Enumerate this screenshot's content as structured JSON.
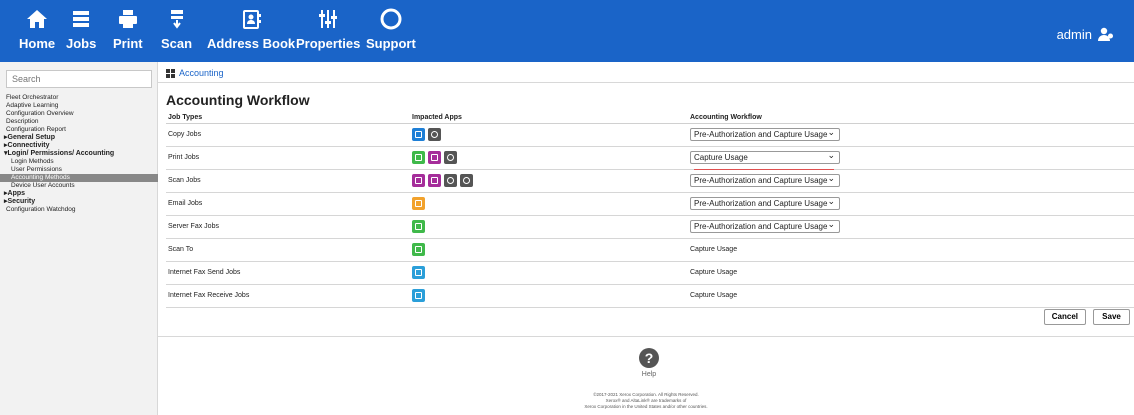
{
  "topbar": {
    "nav": [
      {
        "label": "Home",
        "icon": "home-icon"
      },
      {
        "label": "Jobs",
        "icon": "jobs-icon"
      },
      {
        "label": "Print",
        "icon": "print-icon"
      },
      {
        "label": "Scan",
        "icon": "scan-icon"
      },
      {
        "label": "Address Book",
        "icon": "address-book-icon"
      },
      {
        "label": "Properties",
        "icon": "properties-icon"
      },
      {
        "label": "Support",
        "icon": "support-icon"
      }
    ],
    "user": "admin",
    "bar_color": "#1a64c8"
  },
  "sidebar": {
    "search_placeholder": "Search",
    "items": [
      {
        "label": "Fleet Orchestrator",
        "kind": "item"
      },
      {
        "label": "Adaptive Learning",
        "kind": "item"
      },
      {
        "label": "Configuration Overview",
        "kind": "item"
      },
      {
        "label": "Description",
        "kind": "item"
      },
      {
        "label": "Configuration Report",
        "kind": "item"
      },
      {
        "label": "▸General Setup",
        "kind": "section"
      },
      {
        "label": "▸Connectivity",
        "kind": "section"
      },
      {
        "label": "▾Login/ Permissions/ Accounting",
        "kind": "section"
      },
      {
        "label": "Login Methods",
        "kind": "sub"
      },
      {
        "label": "User Permissions",
        "kind": "sub"
      },
      {
        "label": "Accounting Methods",
        "kind": "sub-active"
      },
      {
        "label": "Device User Accounts",
        "kind": "sub"
      },
      {
        "label": "▸Apps",
        "kind": "section"
      },
      {
        "label": "▸Security",
        "kind": "section"
      },
      {
        "label": "Configuration Watchdog",
        "kind": "item"
      }
    ]
  },
  "breadcrumb": {
    "label": "Accounting"
  },
  "page_title": "Accounting Workflow",
  "table": {
    "headers": [
      "Job Types",
      "Impacted Apps",
      "Accounting Workflow"
    ],
    "rows": [
      {
        "job": "Copy Jobs",
        "apps": [
          {
            "icon": "copy-app-icon",
            "color": "#1e7fd6"
          },
          {
            "icon": "gear-icon",
            "color": "#555555"
          }
        ],
        "workflow": "Pre-Authorization and Capture Usage",
        "editable": true
      },
      {
        "job": "Print Jobs",
        "apps": [
          {
            "icon": "print-app-icon",
            "color": "#3fb94a"
          },
          {
            "icon": "print-usb-app-icon",
            "color": "#a52d9a"
          },
          {
            "icon": "gear-icon",
            "color": "#555555"
          }
        ],
        "workflow": "Capture Usage",
        "editable": true
      },
      {
        "job": "Scan Jobs",
        "apps": [
          {
            "icon": "scan-app-icon",
            "color": "#a52d9a"
          },
          {
            "icon": "scan-usb-app-icon",
            "color": "#a52d9a"
          },
          {
            "icon": "gear-icon",
            "color": "#555555"
          },
          {
            "icon": "gear-icon",
            "color": "#555555"
          }
        ],
        "workflow": "Pre-Authorization and Capture Usage",
        "editable": true
      },
      {
        "job": "Email Jobs",
        "apps": [
          {
            "icon": "email-app-icon",
            "color": "#f2a22c"
          }
        ],
        "workflow": "Pre-Authorization and Capture Usage",
        "editable": true
      },
      {
        "job": "Server Fax Jobs",
        "apps": [
          {
            "icon": "server-fax-app-icon",
            "color": "#3fb94a"
          }
        ],
        "workflow": "Pre-Authorization and Capture Usage",
        "editable": true
      },
      {
        "job": "Scan To",
        "apps": [
          {
            "icon": "scan-to-app-icon",
            "color": "#3fb94a"
          }
        ],
        "workflow": "Capture Usage",
        "editable": false
      },
      {
        "job": "Internet Fax Send Jobs",
        "apps": [
          {
            "icon": "internet-fax-app-icon",
            "color": "#2b9fd9"
          }
        ],
        "workflow": "Capture Usage",
        "editable": false
      },
      {
        "job": "Internet Fax Receive Jobs",
        "apps": [
          {
            "icon": "internet-fax-app-icon",
            "color": "#2b9fd9"
          }
        ],
        "workflow": "Capture Usage",
        "editable": false
      }
    ]
  },
  "buttons": {
    "cancel": "Cancel",
    "save": "Save"
  },
  "footer": {
    "help": "Help",
    "copyright": [
      "©2017-2021 Xerox Corporation. All Rights Reserved.",
      "Xerox® and AltaLink® are trademarks of",
      "Xerox Corporation in the United States and/or other countries."
    ]
  }
}
